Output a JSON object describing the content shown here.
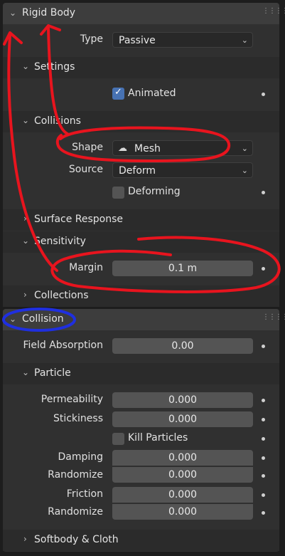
{
  "rigid_body": {
    "title": "Rigid Body",
    "type_label": "Type",
    "type_value": "Passive",
    "settings": {
      "title": "Settings",
      "animated_label": "Animated",
      "animated_checked": true
    },
    "collisions": {
      "title": "Collisions",
      "shape_label": "Shape",
      "shape_value": "Mesh",
      "source_label": "Source",
      "source_value": "Deform",
      "deforming_label": "Deforming",
      "deforming_checked": false
    },
    "surface_response": {
      "title": "Surface Response"
    },
    "sensitivity": {
      "title": "Sensitivity",
      "margin_label": "Margin",
      "margin_value": "0.1 m"
    },
    "collections": {
      "title": "Collections"
    }
  },
  "collision": {
    "title": "Collision",
    "field_absorption_label": "Field Absorption",
    "field_absorption_value": "0.00",
    "particle": {
      "title": "Particle",
      "permeability_label": "Permeability",
      "permeability_value": "0.000",
      "stickiness_label": "Stickiness",
      "stickiness_value": "0.000",
      "kill_particles_label": "Kill Particles",
      "kill_particles_checked": false,
      "damping_label": "Damping",
      "damping_value": "0.000",
      "damping_randomize_label": "Randomize",
      "damping_randomize_value": "0.000",
      "friction_label": "Friction",
      "friction_value": "0.000",
      "friction_randomize_label": "Randomize",
      "friction_randomize_value": "0.000"
    },
    "softbody_cloth": {
      "title": "Softbody & Cloth"
    }
  },
  "annotations": {
    "red_color": "#e8141e",
    "blue_color": "#1f2fe0"
  }
}
